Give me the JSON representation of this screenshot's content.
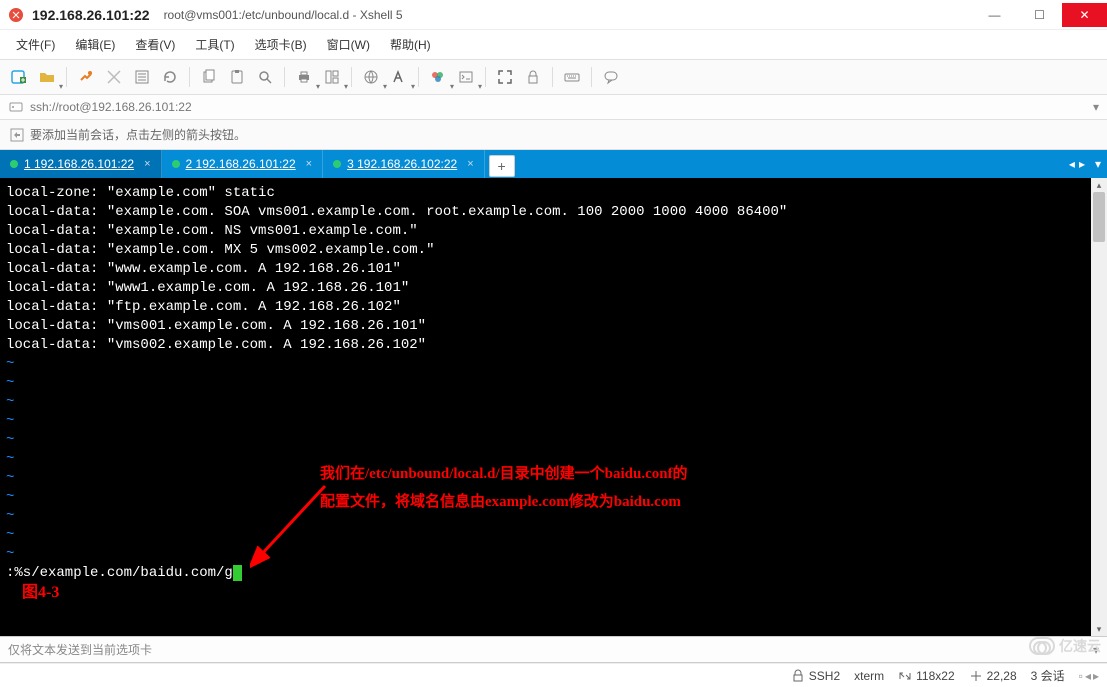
{
  "window": {
    "title_main": "192.168.26.101:22",
    "title_sub": "root@vms001:/etc/unbound/local.d - Xshell 5"
  },
  "menu": {
    "file": "文件(F)",
    "edit": "编辑(E)",
    "view": "查看(V)",
    "tools": "工具(T)",
    "tabs": "选项卡(B)",
    "window": "窗口(W)",
    "help": "帮助(H)"
  },
  "address": {
    "url": "ssh://root@192.168.26.101:22"
  },
  "infobar": {
    "text": "要添加当前会话，点击左侧的箭头按钮。"
  },
  "session_tabs": {
    "tab1": "1 192.168.26.101:22",
    "tab2": "2 192.168.26.101:22",
    "tab3": "3 192.168.26.102:22"
  },
  "terminal": {
    "lines": [
      "local-zone: \"example.com\" static",
      "local-data: \"example.com. SOA vms001.example.com. root.example.com. 100 2000 1000 4000 86400\"",
      "local-data: \"example.com. NS vms001.example.com.\"",
      "local-data: \"example.com. MX 5 vms002.example.com.\"",
      "local-data: \"www.example.com. A 192.168.26.101\"",
      "local-data: \"www1.example.com. A 192.168.26.101\"",
      "local-data: \"ftp.example.com. A 192.168.26.102\"",
      "local-data: \"vms001.example.com. A 192.168.26.101\"",
      "local-data: \"vms002.example.com. A 192.168.26.102\""
    ],
    "command": ":%s/example.com/baidu.com/g"
  },
  "annotation": {
    "fig": "图4-3",
    "line1": "我们在/etc/unbound/local.d/目录中创建一个baidu.conf的",
    "line2": "配置文件，将域名信息由example.com修改为baidu.com"
  },
  "bottom_input": {
    "text": "仅将文本发送到当前选项卡"
  },
  "status": {
    "ssh": "SSH2",
    "term": "xterm",
    "size": "118x22",
    "pos": "22,28",
    "sessions": "3 会话"
  },
  "watermark": {
    "text": "亿速云"
  }
}
